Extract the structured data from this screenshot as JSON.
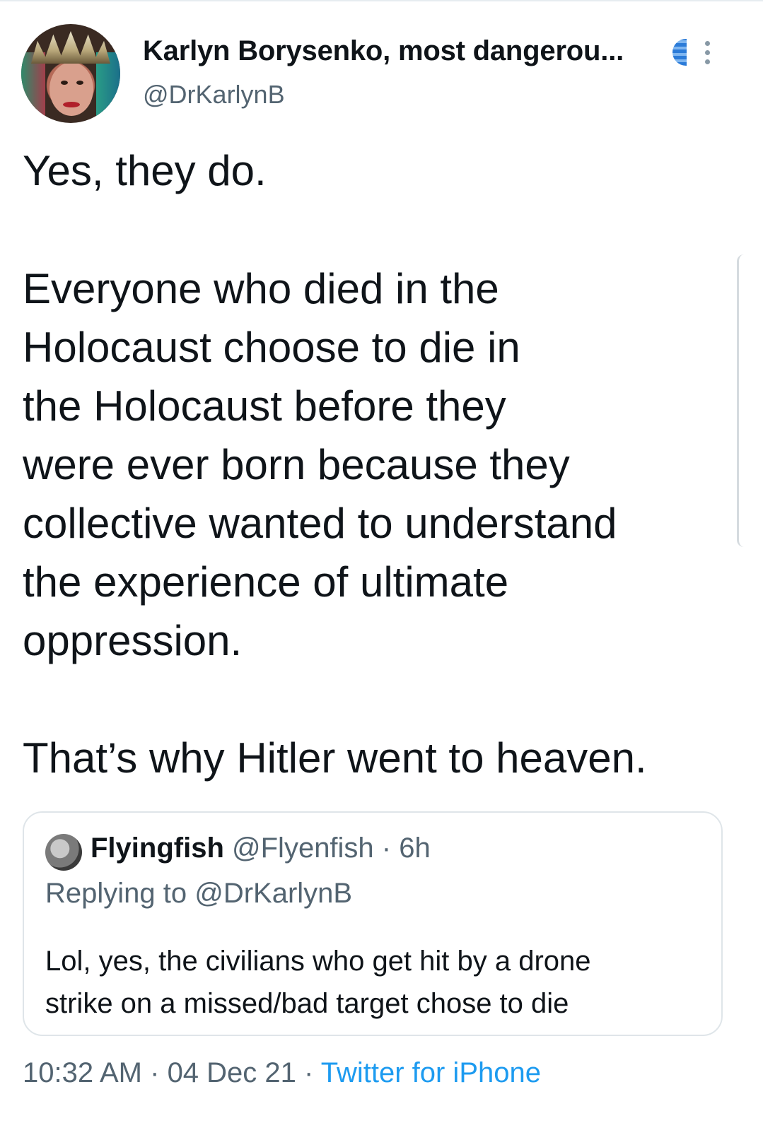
{
  "author": {
    "display_name": "Karlyn Borysenko, most dangerou...",
    "handle": "@DrKarlynB",
    "badge_icon": "globe-icon",
    "menu_icon": "more-vertical-icon"
  },
  "tweet": {
    "line_1": "Yes, they do.",
    "paragraph_2": [
      "Everyone who died in the",
      "Holocaust choose to die in",
      "the Holocaust before they",
      "were ever born because they",
      "collective wanted to understand",
      "the experience of ultimate",
      "oppression."
    ],
    "line_3": "That’s why Hitler went to heaven."
  },
  "quoted_tweet": {
    "name": "Flyingfish",
    "handle": "@Flyenfish",
    "time": "6h",
    "separator": " · ",
    "reply_prefix": "Replying to ",
    "reply_handle": "@DrKarlynB",
    "body_lines": [
      "Lol, yes, the civilians who get hit by a drone",
      "strike on a missed/bad target chose to die"
    ]
  },
  "meta": {
    "time": "10:32 AM",
    "date": "04 Dec 21",
    "separator": " · ",
    "source": "Twitter for iPhone",
    "source_color": "#1d9bf0"
  }
}
